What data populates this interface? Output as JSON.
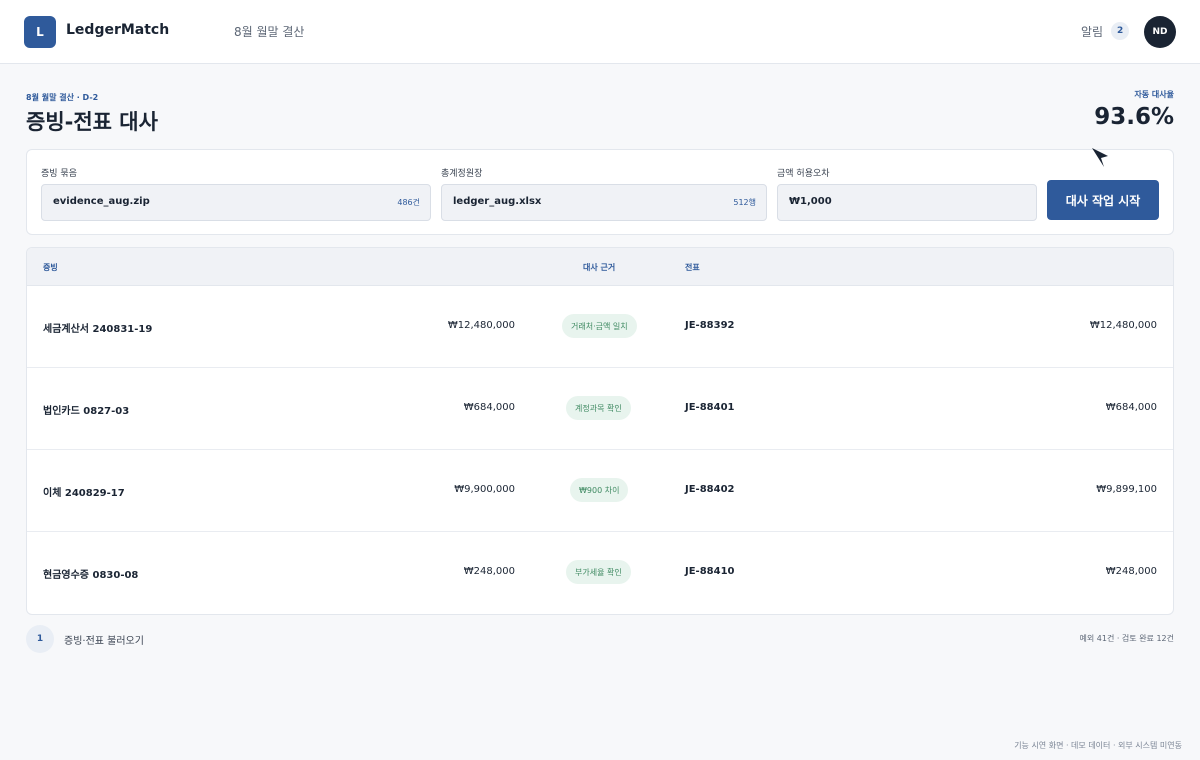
{
  "header": {
    "logo_letter": "L",
    "brand": "LedgerMatch",
    "period": "8월 월말 결산",
    "notifications_label": "알림",
    "notifications_count": "2",
    "avatar_initials": "ND"
  },
  "page": {
    "eyebrow": "8월 월말 결산 · D-2",
    "title": "증빙-전표 대사",
    "rate_label": "자동 대사율",
    "rate_value": "93.6%"
  },
  "form": {
    "evidence_label": "증빙 묶음",
    "evidence_value": "evidence_aug.zip",
    "evidence_meta": "486건",
    "ledger_label": "총계정원장",
    "ledger_value": "ledger_aug.xlsx",
    "ledger_meta": "512행",
    "tolerance_label": "금액 허용오차",
    "tolerance_value": "₩1,000",
    "start_button": "대사 작업 시작"
  },
  "table": {
    "headers": {
      "evidence": "증빙",
      "basis": "대사 근거",
      "entry": "전표"
    },
    "rows": [
      {
        "evidence": "세금계산서 240831-19",
        "evidence_amount": "₩12,480,000",
        "basis": "거래처·금액 일치",
        "entry": "JE-88392",
        "entry_amount": "₩12,480,000"
      },
      {
        "evidence": "법인카드 0827-03",
        "evidence_amount": "₩684,000",
        "basis": "계정과목 확인",
        "entry": "JE-88401",
        "entry_amount": "₩684,000"
      },
      {
        "evidence": "이체 240829-17",
        "evidence_amount": "₩9,900,000",
        "basis": "₩900 차이",
        "entry": "JE-88402",
        "entry_amount": "₩9,899,100"
      },
      {
        "evidence": "현금영수증 0830-08",
        "evidence_amount": "₩248,000",
        "basis": "부가세율 확인",
        "entry": "JE-88410",
        "entry_amount": "₩248,000"
      }
    ]
  },
  "steps": {
    "number": "1",
    "label": "증빙·전표 불러오기",
    "summary": "예외 41건 · 검토 완료 12건"
  },
  "footer": {
    "note": "기능 시연 화면 · 데모 데이터 · 외부 시스템 미연동"
  },
  "colors": {
    "accent": "#2f5a9b",
    "ink": "#1a2433",
    "chip_bg": "#e8f4ee",
    "chip_text": "#3f8a62"
  }
}
